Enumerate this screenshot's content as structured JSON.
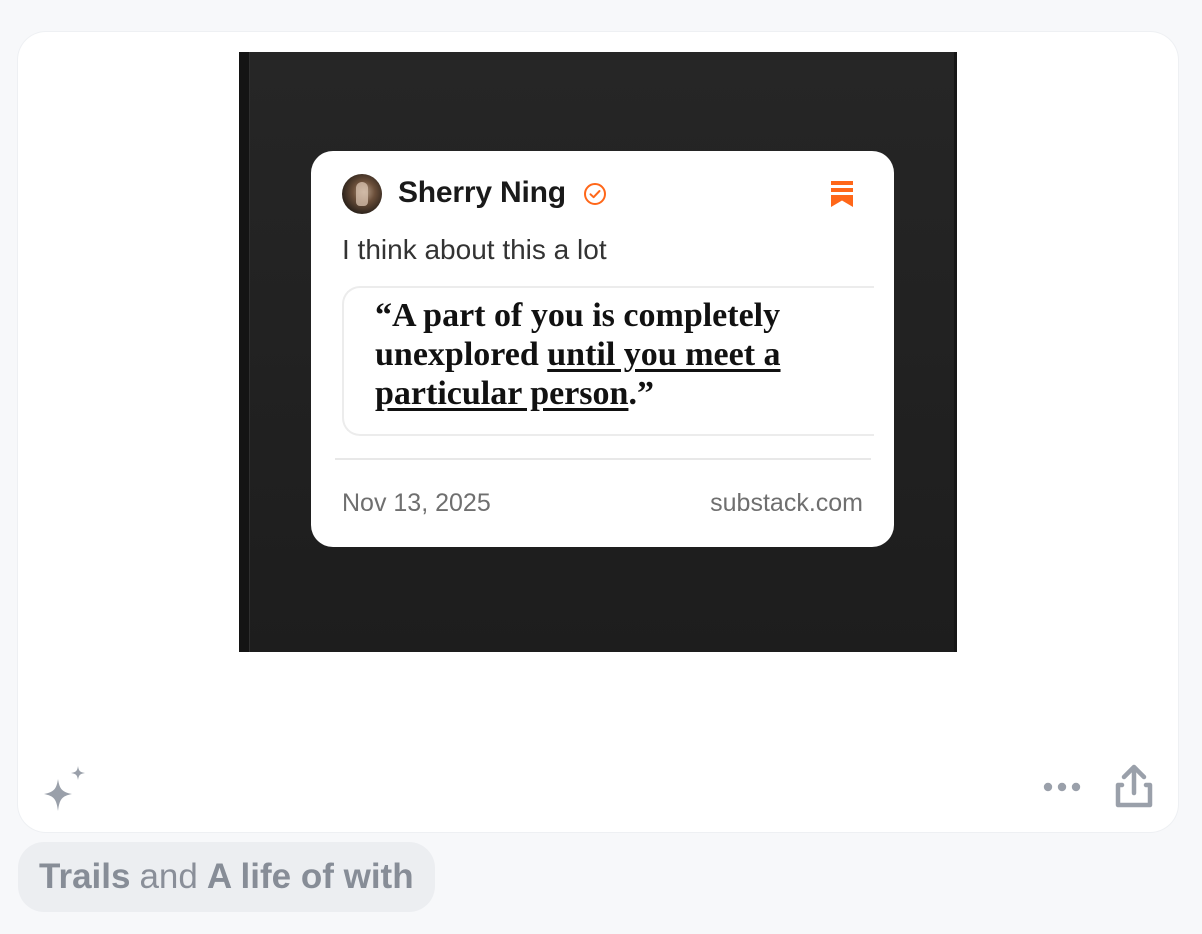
{
  "post": {
    "note": {
      "author": "Sherry Ning",
      "verified_icon": "verified-badge-icon",
      "bookmark_icon": "substack-logo-icon",
      "text": "I think about this a lot",
      "quote": {
        "line1": "“A part of you is completely",
        "line2_plain": "unexplored ",
        "line2_underlined": "until you meet a",
        "line3_underlined": "particular person",
        "line3_end": ".”"
      },
      "date": "Nov 13, 2025",
      "domain": "substack.com"
    },
    "actions": {
      "sparkle_icon": "sparkle-icon",
      "more_icon": "more-dots-icon",
      "share_icon": "share-icon"
    }
  },
  "tag": {
    "first": "Trails",
    "joiner": "and",
    "second": "A life of with"
  },
  "colors": {
    "accent": "#ff6719",
    "icon_gray": "#9aa0aa",
    "background": "#f7f8fa"
  }
}
